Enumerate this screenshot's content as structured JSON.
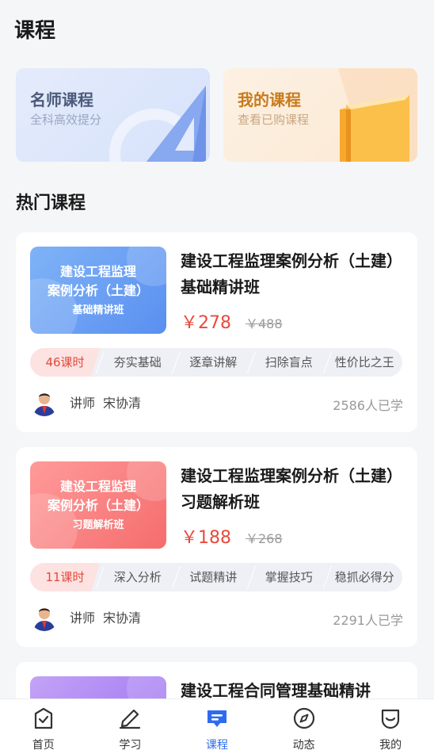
{
  "header": {
    "title": "课程"
  },
  "banners": [
    {
      "title": "名师课程",
      "subtitle": "全科高效提分"
    },
    {
      "title": "我的课程",
      "subtitle": "查看已购课程"
    }
  ],
  "section": {
    "title": "热门课程"
  },
  "courses": [
    {
      "thumb": [
        "建设工程监理",
        "案例分析（土建）",
        "基础精讲班"
      ],
      "title": "建设工程监理案例分析（土建）基础精讲班",
      "price": "￥278",
      "original_price": "￥488",
      "lessons": "46课时",
      "tags": [
        "夯实基础",
        "逐章讲解",
        "扫除盲点",
        "性价比之王"
      ],
      "teacher_label": "讲师",
      "teacher_name": "宋协清",
      "learners": "2586人已学"
    },
    {
      "thumb": [
        "建设工程监理",
        "案例分析（土建）",
        "习题解析班"
      ],
      "title": "建设工程监理案例分析（土建）习题解析班",
      "price": "￥188",
      "original_price": "￥268",
      "lessons": "11课时",
      "tags": [
        "深入分析",
        "试题精讲",
        "掌握技巧",
        "稳抓必得分"
      ],
      "teacher_label": "讲师",
      "teacher_name": "宋协清",
      "learners": "2291人已学"
    },
    {
      "title": "建设工程合同管理基础精讲"
    }
  ],
  "tabbar": [
    {
      "label": "首页",
      "icon": "home-icon"
    },
    {
      "label": "学习",
      "icon": "study-icon"
    },
    {
      "label": "课程",
      "icon": "course-icon",
      "active": true
    },
    {
      "label": "动态",
      "icon": "compass-icon"
    },
    {
      "label": "我的",
      "icon": "profile-icon"
    }
  ],
  "colors": {
    "accent": "#2f6bf0",
    "price": "#e84a3c",
    "banner_gold": "#c77b1c"
  }
}
